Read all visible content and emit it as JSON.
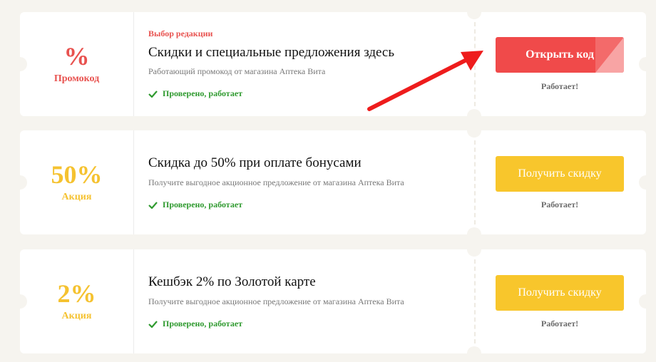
{
  "coupons": [
    {
      "badge_big": "%",
      "badge_small": "Промокод",
      "editor_pick": "Выбор редакции",
      "title": "Скидки и специальные предложения здесь",
      "description": "Работающий промокод от магазина Аптека Вита",
      "verified": "Проверено, работает",
      "button_label": "Открыть код",
      "status": "Работает!"
    },
    {
      "badge_big": "50%",
      "badge_small": "Акция",
      "title": "Скидка до 50% при оплате бонусами",
      "description": "Получите выгодное акционное предложение от магазина Аптека Вита",
      "verified": "Проверено, работает",
      "button_label": "Получить скидку",
      "status": "Работает!"
    },
    {
      "badge_big": "2%",
      "badge_small": "Акция",
      "title": "Кешбэк 2% по Золотой карте",
      "description": "Получите выгодное акционное предложение от магазина Аптека Вита",
      "verified": "Проверено, работает",
      "button_label": "Получить скидку",
      "status": "Работает!"
    }
  ],
  "colors": {
    "accent_red": "#f04a4a",
    "accent_yellow": "#f8c62c",
    "verified_green": "#2f9a2f",
    "background": "#f6f4ef"
  },
  "icons": {
    "verified": "check-icon",
    "annotation": "red-arrow-icon"
  }
}
